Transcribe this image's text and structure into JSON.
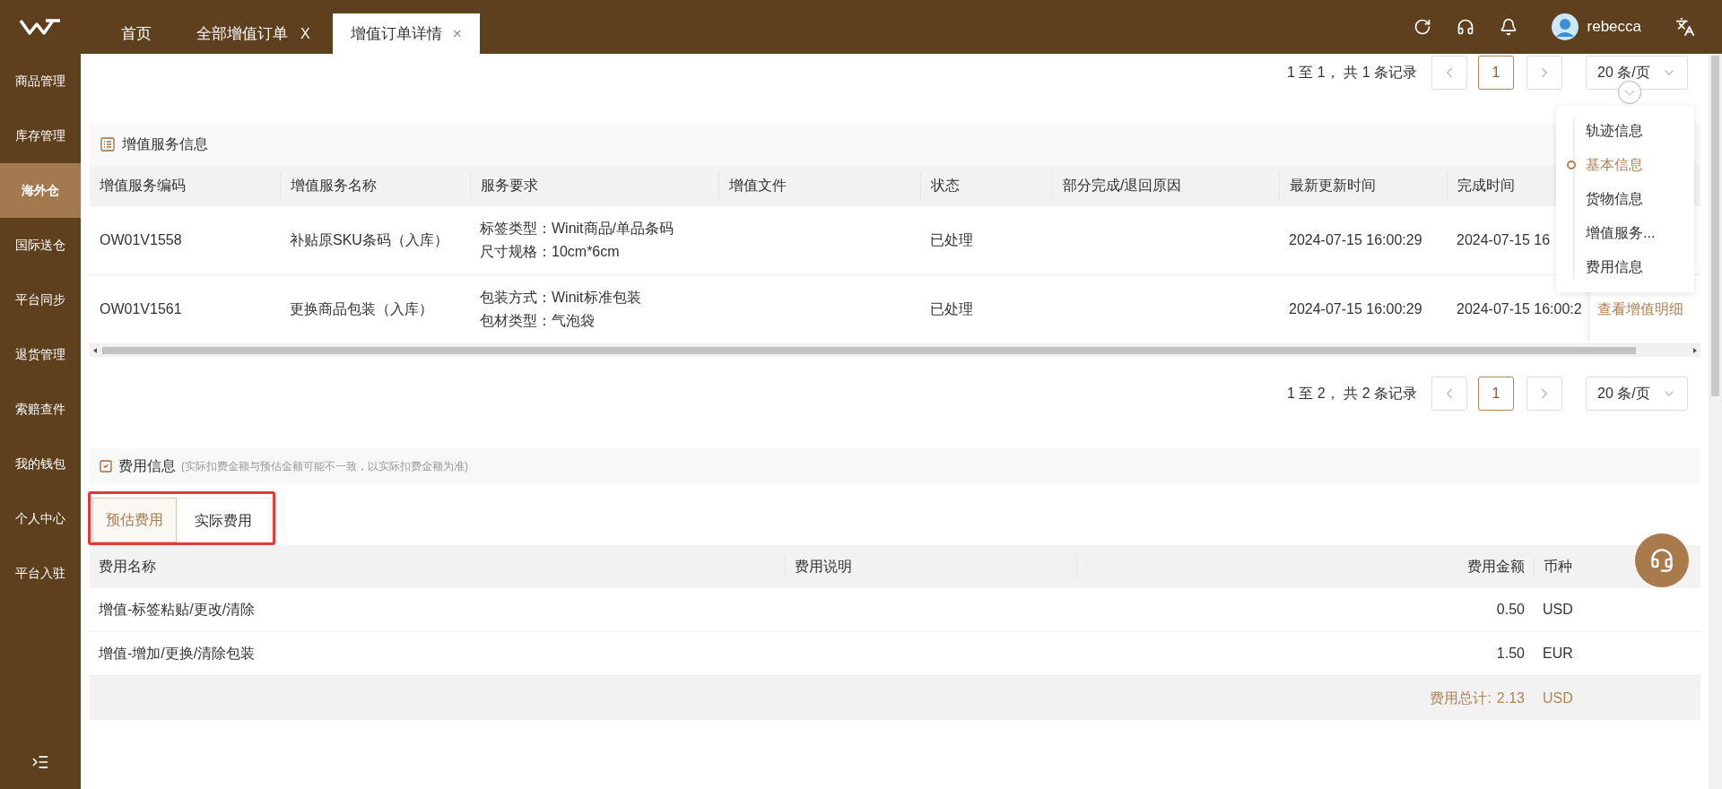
{
  "top_bar": {
    "tabs": [
      {
        "label": "首页",
        "selected": false
      },
      {
        "label": "全部增值订单",
        "selected": false,
        "close": "X"
      },
      {
        "label": "增值订单详情",
        "selected": true,
        "close": "×"
      }
    ],
    "user": {
      "name": "rebecca"
    }
  },
  "sidebar": {
    "items": [
      {
        "label": "商品管理",
        "selected": false
      },
      {
        "label": "库存管理",
        "selected": false
      },
      {
        "label": "海外仓",
        "selected": true
      },
      {
        "label": "国际送仓",
        "selected": false
      },
      {
        "label": "平台同步",
        "selected": false
      },
      {
        "label": "退货管理",
        "selected": false
      },
      {
        "label": "索赔查件",
        "selected": false
      },
      {
        "label": "我的钱包",
        "selected": false
      },
      {
        "label": "个人中心",
        "selected": false
      },
      {
        "label": "平台入驻",
        "selected": false
      }
    ]
  },
  "top_pagination": {
    "summary": "1 至 1， 共 1 条记录",
    "pages": [
      {
        "label": "1",
        "selected": true
      }
    ],
    "page_size": "20 条/页"
  },
  "value_added_services": {
    "title": "增值服务信息",
    "columns": [
      "增值服务编码",
      "增值服务名称",
      "服务要求",
      "增值文件",
      "状态",
      "部分完成/退回原因",
      "最新更新时间",
      "完成时间"
    ],
    "rows": [
      {
        "code": "OW01V1558",
        "name": "补贴原SKU条码（入库）",
        "requirements": [
          "标签类型：Winit商品/单品条码",
          "尺寸规格：10cm*6cm"
        ],
        "status": "已处理",
        "updated": "2024-07-15 16:00:29",
        "completed": "2024-07-15 16"
      },
      {
        "code": "OW01V1561",
        "name": "更换商品包装（入库）",
        "requirements": [
          "包装方式：Winit标准包装",
          "包材类型：气泡袋"
        ],
        "status": "已处理",
        "updated": "2024-07-15 16:00:29",
        "completed": "2024-07-15 16:00:2",
        "action": "查看增值明细"
      }
    ],
    "pagination": {
      "summary": "1 至 2， 共 2 条记录",
      "pages": [
        {
          "label": "1",
          "selected": true
        }
      ],
      "page_size": "20 条/页"
    }
  },
  "anchor_nav": {
    "items": [
      {
        "label": "轨迹信息",
        "selected": false
      },
      {
        "label": "基本信息",
        "selected": true
      },
      {
        "label": "货物信息",
        "selected": false
      },
      {
        "label": "增值服务...",
        "selected": false
      },
      {
        "label": "费用信息",
        "selected": false
      }
    ]
  },
  "fees": {
    "title": "费用信息",
    "note": "(实际扣费金额与预估金额可能不一致，以实际扣费金额为准)",
    "tabs": [
      {
        "label": "预估费用",
        "selected": true
      },
      {
        "label": "实际费用",
        "selected": false
      }
    ],
    "columns": [
      "费用名称",
      "费用说明",
      "费用金额",
      "币种"
    ],
    "rows": [
      {
        "name": "增值-标签粘贴/更改/清除",
        "amount": "0.50",
        "currency": "USD"
      },
      {
        "name": "增值-增加/更换/清除包装",
        "amount": "1.50",
        "currency": "EUR"
      }
    ],
    "total": {
      "label": "费用总计:",
      "amount": "2.13",
      "currency": "USD"
    }
  }
}
